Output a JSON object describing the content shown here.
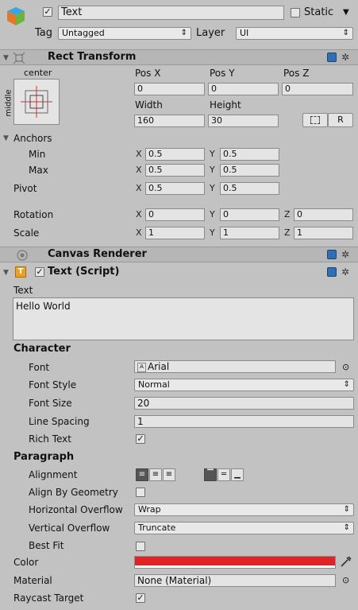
{
  "header": {
    "name_value": "Text",
    "static_label": "Static",
    "tag_label": "Tag",
    "tag_value": "Untagged",
    "layer_label": "Layer",
    "layer_value": "UI",
    "dropdown_arrow": "⇕"
  },
  "rect_transform": {
    "title": "Rect Transform",
    "anchor_preset_top": "center",
    "anchor_preset_side": "middle",
    "pos_x_label": "Pos X",
    "pos_y_label": "Pos Y",
    "pos_z_label": "Pos Z",
    "pos_x": "0",
    "pos_y": "0",
    "pos_z": "0",
    "width_label": "Width",
    "height_label": "Height",
    "width": "160",
    "height": "30",
    "r_button": "R",
    "anchors_label": "Anchors",
    "min_label": "Min",
    "max_label": "Max",
    "min_x": "0.5",
    "min_y": "0.5",
    "max_x": "0.5",
    "max_y": "0.5",
    "pivot_label": "Pivot",
    "pivot_x": "0.5",
    "pivot_y": "0.5",
    "rotation_label": "Rotation",
    "rot_x": "0",
    "rot_y": "0",
    "rot_z": "0",
    "scale_label": "Scale",
    "scale_x": "1",
    "scale_y": "1",
    "scale_z": "1",
    "axis_x": "X",
    "axis_y": "Y",
    "axis_z": "Z"
  },
  "canvas_renderer": {
    "title": "Canvas Renderer"
  },
  "text_script": {
    "title": "Text (Script)",
    "text_label": "Text",
    "text_value": "Hello World",
    "character_header": "Character",
    "font_label": "Font",
    "font_value": "Arial",
    "font_style_label": "Font Style",
    "font_style_value": "Normal",
    "font_size_label": "Font Size",
    "font_size_value": "20",
    "line_spacing_label": "Line Spacing",
    "line_spacing_value": "1",
    "rich_text_label": "Rich Text",
    "rich_text_checked": "✓",
    "paragraph_header": "Paragraph",
    "alignment_label": "Alignment",
    "align_by_geometry_label": "Align By Geometry",
    "horizontal_overflow_label": "Horizontal Overflow",
    "horizontal_overflow_value": "Wrap",
    "vertical_overflow_label": "Vertical Overflow",
    "vertical_overflow_value": "Truncate",
    "best_fit_label": "Best Fit",
    "color_label": "Color",
    "color_value": "#e02424",
    "material_label": "Material",
    "material_value": "None (Material)",
    "raycast_label": "Raycast Target",
    "raycast_checked": "✓",
    "component_checked": "✓",
    "script_icon_letter": "T"
  },
  "colors": {
    "panel": "#c2c2c2",
    "header": "#b6b6b6",
    "selected_align": "#555555",
    "book_icon": "#2f6fb3"
  }
}
